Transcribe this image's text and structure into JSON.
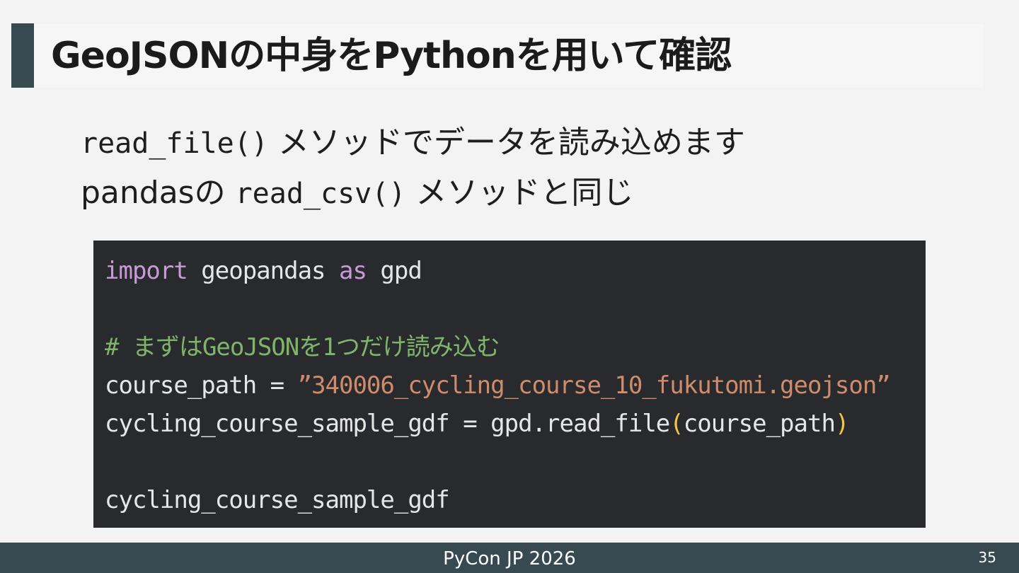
{
  "slide": {
    "title": "GeoJSONの中身をPythonを用いて確認",
    "bullets": [
      {
        "code": "read_file()",
        "text": " メソッドでデータを読み込めます"
      },
      {
        "pre": "pandasの ",
        "code": "read_csv()",
        "text": " メソッドと同じ"
      }
    ]
  },
  "code": {
    "line1": {
      "kw1": "import",
      "t1": " geopandas ",
      "kw2": "as",
      "t2": " gpd"
    },
    "comment": "# まずはGeoJSONを1つだけ読み込む",
    "line3": {
      "var": "course_path = ",
      "str": "”340006_cycling_course_10_fukutomi.geojson”"
    },
    "line4": {
      "pre": "cycling_course_sample_gdf = gpd.read_file",
      "open": "(",
      "arg": "course_path",
      "close": ")"
    },
    "line5": "cycling_course_sample_gdf"
  },
  "footer": {
    "text": "PyCon JP 2026",
    "page_number": "35"
  },
  "colors": {
    "accent": "#374951",
    "code_bg": "#282a2d",
    "keyword": "#c89bd6",
    "comment": "#7fb56a",
    "string": "#d08c6a",
    "paren": "#f2c744"
  }
}
